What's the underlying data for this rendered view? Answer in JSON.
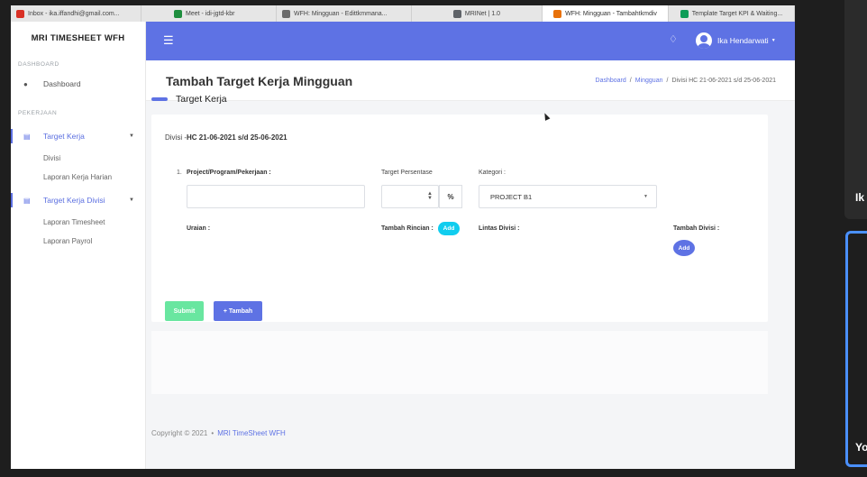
{
  "browser": {
    "tabs": [
      {
        "title": "Inbox - ika.iffandhi@gmail.com...",
        "color": "#d93025"
      },
      {
        "title": "Meet - idi-jgtd-kbr",
        "color": "#1e8e3e"
      },
      {
        "title": "WFH: Mingguan - Edittkmmana...",
        "color": "#6b6b6b"
      },
      {
        "title": "MRINet | 1.0",
        "color": "#5f6368"
      },
      {
        "title": "WFH: Mingguan - Tambahtkmdiv",
        "color": "#e8710a"
      },
      {
        "title": "Template Target KPI & Waiting...",
        "color": "#0f9d58"
      }
    ]
  },
  "sidebar": {
    "brand": "MRI TIMESHEET WFH",
    "section_dashboard": "DASHBOARD",
    "dashboard_label": "Dashboard",
    "section_pekerjaan": "PEKERJAAN",
    "target_kerja": "Target Kerja",
    "sub_divisi": "Divisi",
    "sub_laporan_harian": "Laporan Kerja Harian",
    "target_kerja_divisi": "Target Kerja Divisi",
    "sub_laporan_timesheet": "Laporan Timesheet",
    "sub_laporan_payrol": "Laporan Payrol"
  },
  "topbar": {
    "user_name": "Ika Hendarwati"
  },
  "page": {
    "title": "Tambah Target Kerja Mingguan",
    "breadcrumb": {
      "dashboard": "Dashboard",
      "sep1": "/",
      "mingguan": "Mingguan",
      "sep2": "/",
      "current": "Divisi HC 21-06-2021 s/d 25-06-2021"
    }
  },
  "card": {
    "title": "Target Kerja",
    "divisi_prefix": "Divisi -",
    "divisi_value": "HC 21-06-2021 s/d 25-06-2021",
    "row_number": "1.",
    "label_project": "Project/Program/Pekerjaan :",
    "label_target": "Target Persentase",
    "label_kategori": "Kategori :",
    "project_value": "",
    "target_value": "",
    "percent_symbol": "%",
    "kategori_value": "PROJECT B1",
    "label_uraian": "Uraian :",
    "label_tambah_rincian": "Tambah Rincian :",
    "add_label": "Add",
    "label_lintas_divisi": "Lintas Divisi :",
    "label_tambah_divisi": "Tambah Divisi :",
    "add_divisi_label": "Add",
    "submit_label": "Submit",
    "tambah_label": "+ Tambah"
  },
  "footer": {
    "copyright": "Copyright © 2021",
    "dot": "•",
    "app_name": "MRI TimeSheet WFH"
  },
  "side": {
    "letter1": "Ik",
    "letter2": "Yo"
  },
  "colors": {
    "primary": "#5e72e4",
    "info": "#11cdef",
    "success": "#69e6a0"
  }
}
